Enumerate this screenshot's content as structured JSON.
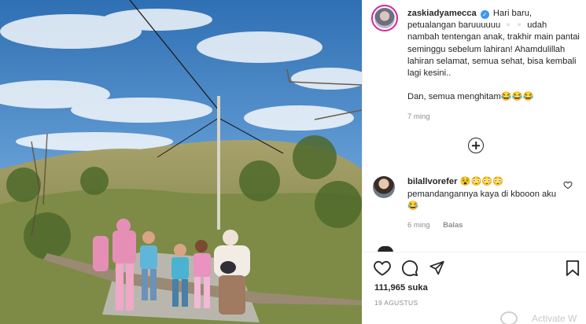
{
  "post": {
    "username": "zaskiadyamecca",
    "caption": "Hari baru, petualangan baruuuuuu ▫️▫️ udah nambah tentengan anak, trakhir main pantai seminggu sebelum lahiran! Ahamdulillah lahiran selamat, semua sehat, bisa kembali lagi kesini..\n\nDan, semua menghitam😂😂😂",
    "time": "7 ming"
  },
  "comment": {
    "username": "bilallvorefer",
    "emojis": "😵😳😳😳",
    "text": "pemandangannya kaya di kbooon aku😂",
    "time": "6 ming",
    "reply_label": "Balas"
  },
  "likes": "111,965 suka",
  "date": "19 AGUSTUS",
  "watermark": "Activate W",
  "icons": {
    "like": "heart-icon",
    "comment": "comment-icon",
    "share": "send-icon",
    "save": "bookmark-icon",
    "more": "plus-circle-icon"
  },
  "colors": {
    "verified": "#3897f0",
    "muted": "#8e8e8e",
    "text": "#262626"
  }
}
